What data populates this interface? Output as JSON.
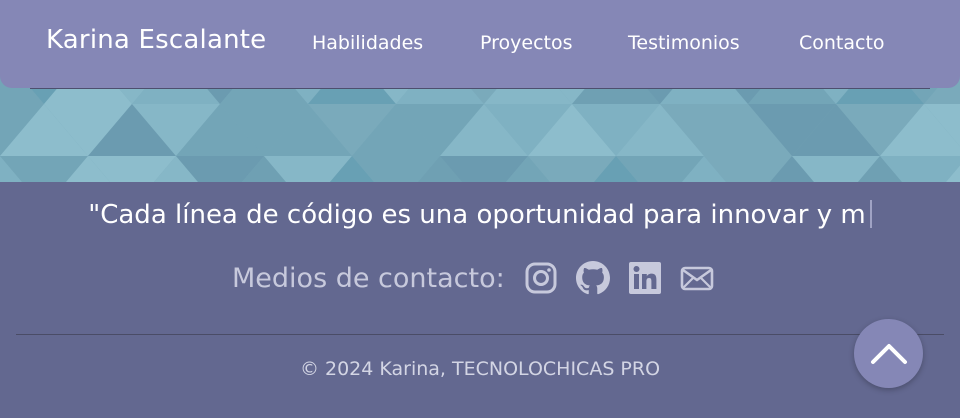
{
  "header": {
    "brand": "Karina Escalante",
    "nav": [
      {
        "label": "Habilidades"
      },
      {
        "label": "Proyectos"
      },
      {
        "label": "Testimonios"
      },
      {
        "label": "Contacto"
      }
    ]
  },
  "footer": {
    "quote": "\"Cada línea de código es una oportunidad para innovar y m",
    "contact_label": "Medios de contacto:",
    "social_icons": [
      "instagram-icon",
      "github-icon",
      "linkedin-icon",
      "mail-icon"
    ],
    "copyright": "© 2024 Karina, TECNOLOCHICAS PRO"
  },
  "colors": {
    "navbar": "#8587b6",
    "footer_bg": "#636890",
    "pattern_base": "#7aaabb",
    "icon": "#c7c9dc"
  }
}
